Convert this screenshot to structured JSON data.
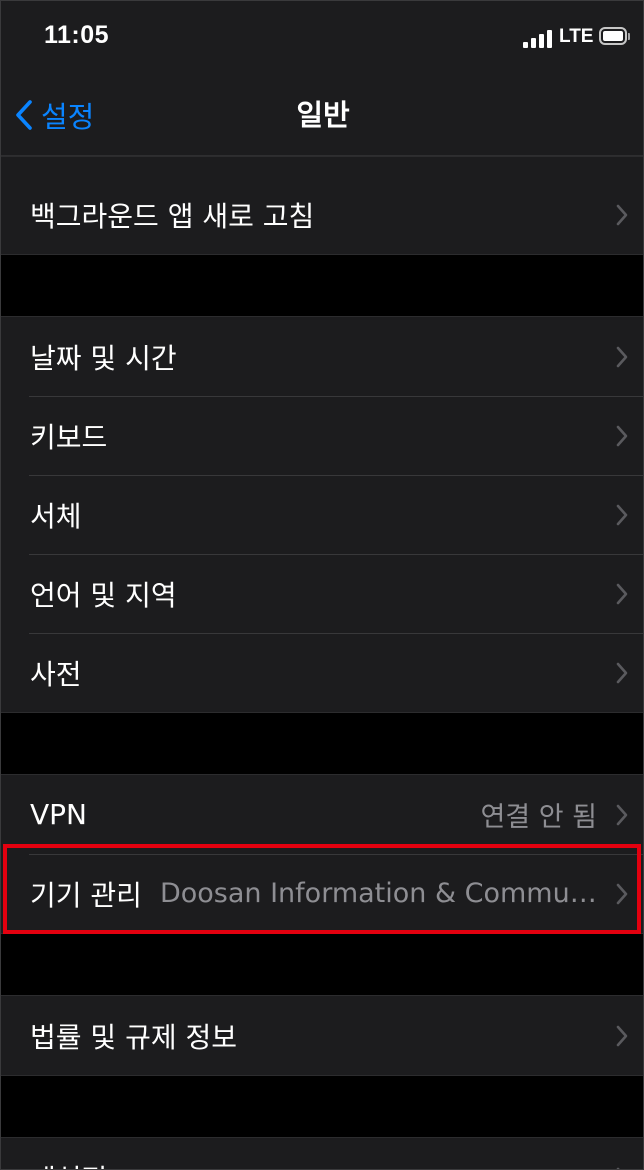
{
  "status_bar": {
    "time": "11:05",
    "network": "LTE",
    "signal_bars": 4,
    "battery_level": 0.85
  },
  "nav": {
    "back_label": "설정",
    "title": "일반"
  },
  "groups": [
    {
      "items": [
        {
          "label": "백그라운드 앱 새로 고침",
          "value": ""
        }
      ]
    },
    {
      "items": [
        {
          "label": "날짜 및 시간",
          "value": ""
        },
        {
          "label": "키보드",
          "value": ""
        },
        {
          "label": "서체",
          "value": ""
        },
        {
          "label": "언어 및 지역",
          "value": ""
        },
        {
          "label": "사전",
          "value": ""
        }
      ]
    },
    {
      "items": [
        {
          "label": "VPN",
          "value": "연결 안 됨"
        },
        {
          "label": "기기 관리",
          "value": "Doosan Information & Commun..."
        }
      ]
    },
    {
      "items": [
        {
          "label": "법률 및 규제 정보",
          "value": ""
        }
      ]
    },
    {
      "items": [
        {
          "label": "재설정",
          "value": ""
        }
      ]
    }
  ],
  "colors": {
    "accent": "#0a84ff",
    "highlight": "#e3000f",
    "cell_background": "#1c1c1e",
    "secondary_text": "#8e8e93"
  },
  "icons": {
    "back": "chevron-left-icon",
    "disclosure": "chevron-right-icon"
  }
}
